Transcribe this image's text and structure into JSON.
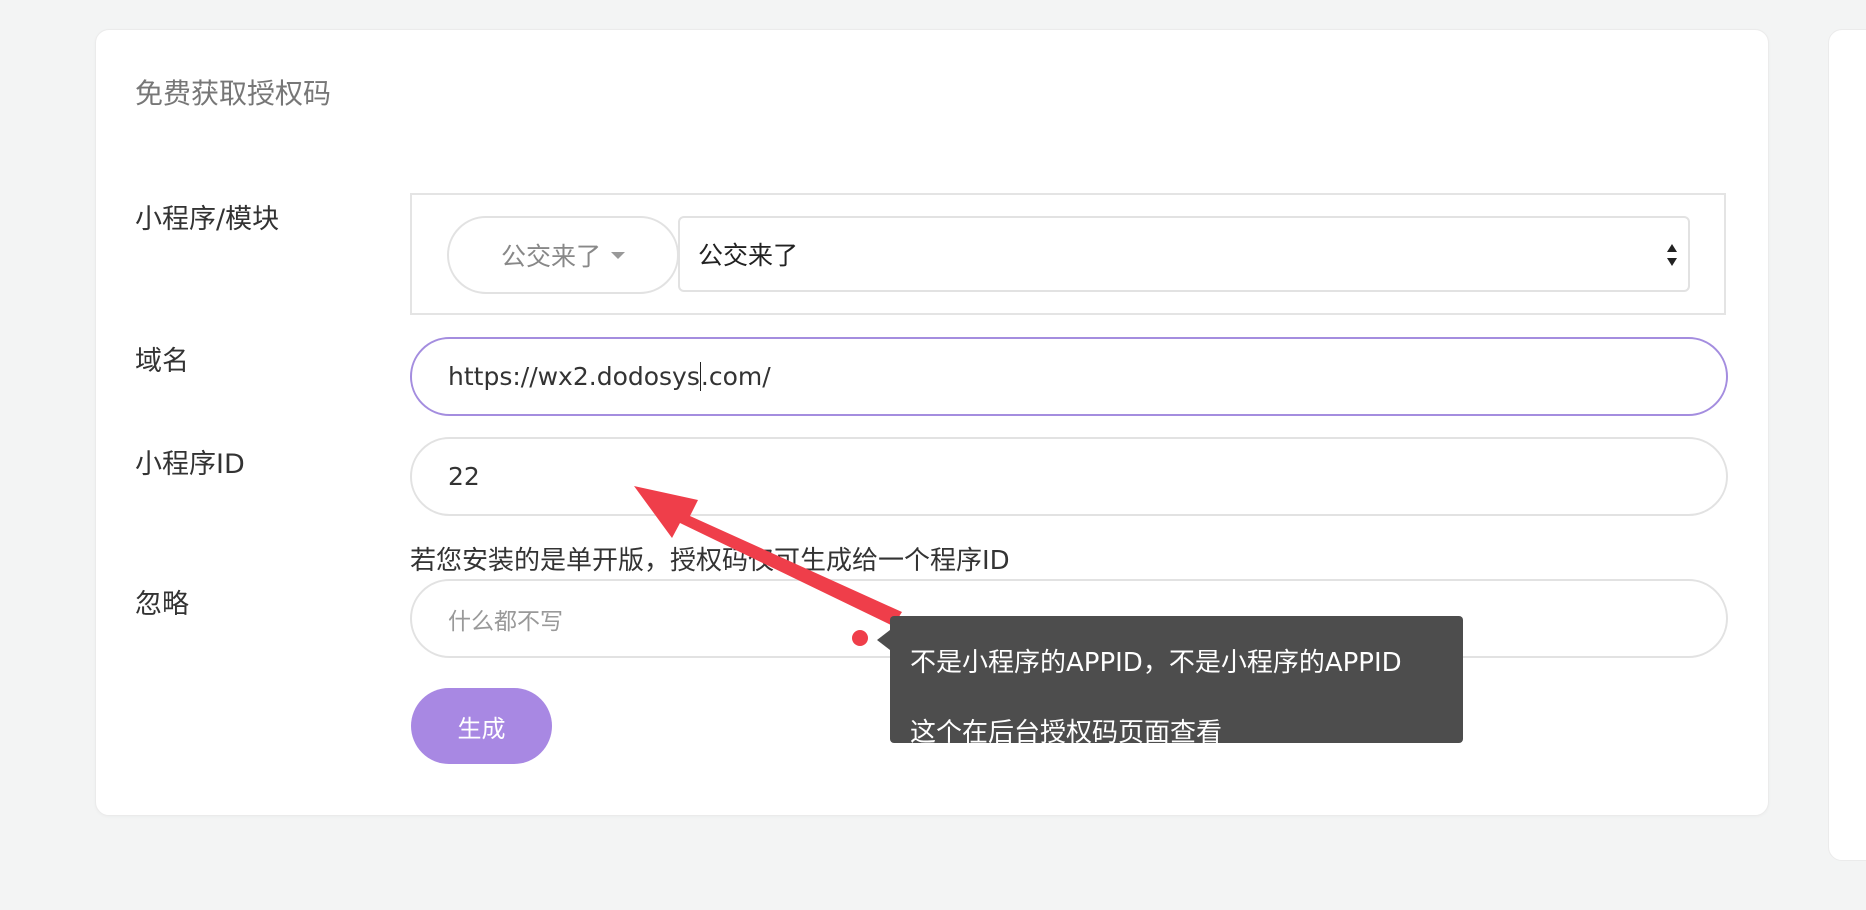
{
  "form": {
    "title": "免费获取授权码",
    "module_label": "小程序/模块",
    "module_pill": "公交来了",
    "module_select_value": "公交来了",
    "domain_label": "域名",
    "domain_value_before_cursor": "https://wx2.dodosys",
    "domain_value_after_cursor": ".com/",
    "appid_label": "小程序ID",
    "appid_value": "22",
    "help_text": "若您安装的是单开版，授权码仅可生成给一个程序ID",
    "ignore_label": "忽略",
    "ignore_placeholder": "什么都不写",
    "generate_button": "生成"
  },
  "tooltip": {
    "line1": "不是小程序的APPID，不是小程序的APPID",
    "line2": "这个在后台授权码页面查看"
  },
  "colors": {
    "accent": "#a888e3",
    "focus_border": "#a48ddf",
    "annotation_red": "#ef3e4a",
    "tooltip_bg": "#4d4d4d"
  }
}
